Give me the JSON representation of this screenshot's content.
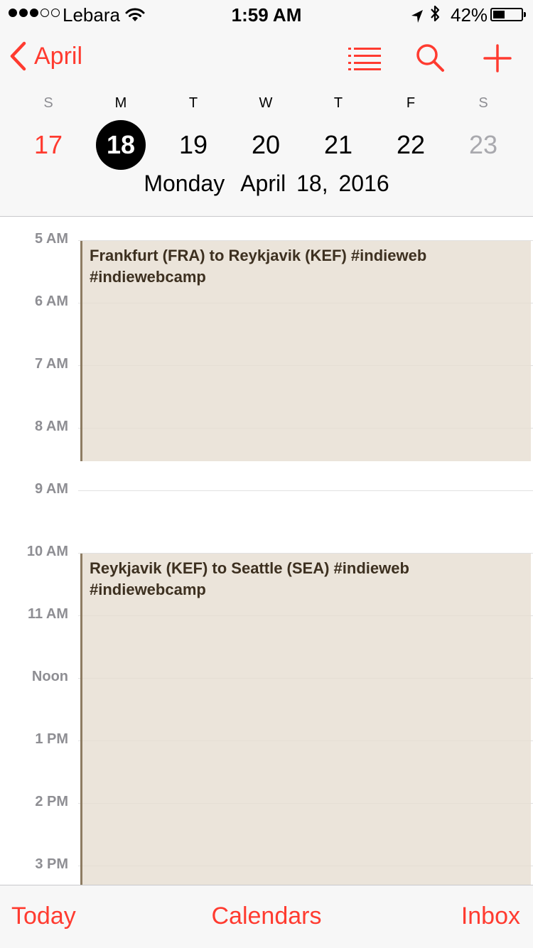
{
  "status_bar": {
    "signal_bars_filled": 3,
    "signal_bars_total": 5,
    "carrier": "Lebara",
    "time": "1:59 AM",
    "battery_percent": "42%",
    "battery_level": 0.42,
    "icons": [
      "wifi-icon",
      "location-arrow-icon",
      "bluetooth-icon",
      "battery-icon"
    ]
  },
  "nav": {
    "back_label": "April",
    "icons": [
      "chevron-left-icon",
      "list-icon",
      "search-icon",
      "plus-icon"
    ]
  },
  "week": {
    "day_initials": [
      "S",
      "M",
      "T",
      "W",
      "T",
      "F",
      "S"
    ],
    "dates": [
      "17",
      "18",
      "19",
      "20",
      "21",
      "22",
      "23"
    ],
    "selected_index": 1
  },
  "day_title": {
    "weekday": "Monday",
    "date": "April 18, 2016"
  },
  "timeline": {
    "hours": [
      "5 AM",
      "6 AM",
      "7 AM",
      "8 AM",
      "9 AM",
      "10 AM",
      "11 AM",
      "Noon",
      "1 PM",
      "2 PM",
      "3 PM"
    ],
    "events": [
      {
        "title": "Frankfurt (FRA) to Reykjavik (KEF) #indieweb #indiewebcamp"
      },
      {
        "title": "Reykjavik (KEF) to Seattle (SEA) #indieweb #indiewebcamp"
      }
    ]
  },
  "toolbar": {
    "today_label": "Today",
    "calendars_label": "Calendars",
    "inbox_label": "Inbox"
  },
  "colors": {
    "accent": "#ff3b30",
    "event_fill": "#ebe4dc",
    "event_border": "#8d7c62"
  }
}
